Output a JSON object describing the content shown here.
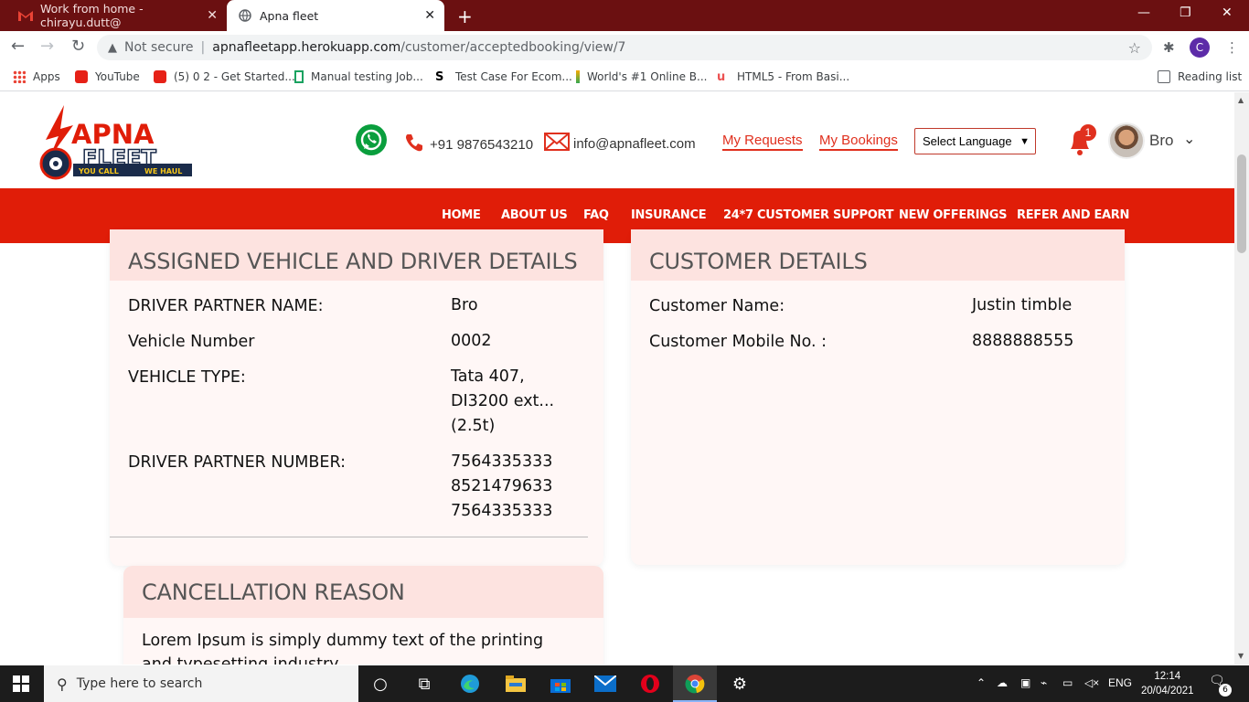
{
  "browser": {
    "tabs": [
      {
        "title": "Work from home - chirayu.dutt@",
        "active": false
      },
      {
        "title": "Apna fleet",
        "active": true
      }
    ],
    "new_tab": "+",
    "window_controls": {
      "minimize": "—",
      "maximize": "❐",
      "close": "✕"
    },
    "security_label": "Not secure",
    "url_host": "apnafleetapp.herokuapp.com",
    "url_path": "/customer/acceptedbooking/view/7",
    "profile_initial": "C",
    "bookmarks": [
      {
        "label": "Apps",
        "icon": "apps-grid-icon"
      },
      {
        "label": "YouTube",
        "icon": "youtube-icon"
      },
      {
        "label": "(5) 0 2 - Get Started...",
        "icon": "youtube-icon"
      },
      {
        "label": "Manual testing Job...",
        "icon": "bookmark-green-icon"
      },
      {
        "label": "Test Case For Ecom...",
        "icon": "s-logo-icon"
      },
      {
        "label": "World's #1 Online B...",
        "icon": "bars-icon"
      },
      {
        "label": "HTML5 - From Basi...",
        "icon": "udemy-icon"
      }
    ],
    "reading_list": "Reading list"
  },
  "site": {
    "logo": {
      "line1": "APNA",
      "line2": "FLEET",
      "tagline_left": "YOU CALL",
      "tagline_right": "WE HAUL"
    },
    "phone": "+91 9876543210",
    "email": "info@apnafleet.com",
    "my_requests": "My Requests",
    "my_bookings": "My Bookings",
    "language_select": "Select Language",
    "notification_count": "1",
    "user_name": "Bro",
    "nav": [
      "HOME",
      "ABOUT US",
      "FAQ",
      "INSURANCE",
      "24*7 CUSTOMER SUPPORT",
      "NEW OFFERINGS",
      "REFER AND EARN"
    ],
    "colors": {
      "brand_red": "#e01d08",
      "card_head": "#fde3e0",
      "card_bg": "#fff7f6"
    }
  },
  "vehicle_card": {
    "title": "ASSIGNED VEHICLE AND DRIVER DETAILS",
    "rows": [
      {
        "label": "DRIVER PARTNER NAME:",
        "value": "Bro"
      },
      {
        "label": "Vehicle Number",
        "value": "0002"
      },
      {
        "label": "VEHICLE TYPE:",
        "value_lines": [
          "Tata 407,",
          "DI3200 ext...",
          "(2.5t)"
        ]
      },
      {
        "label": "DRIVER PARTNER NUMBER:",
        "value_lines": [
          "7564335333",
          "8521479633",
          "7564335333"
        ]
      }
    ]
  },
  "customer_card": {
    "title": "CUSTOMER DETAILS",
    "rows": [
      {
        "label": "Customer Name:",
        "value": "Justin timble"
      },
      {
        "label": "Customer Mobile No. :",
        "value": "8888888555"
      }
    ]
  },
  "cancellation_card": {
    "title": "CANCELLATION REASON",
    "text": "Lorem Ipsum is simply dummy text of the printing and typesetting industry."
  },
  "taskbar": {
    "search_placeholder": "Type here to search",
    "language": "ENG",
    "time": "12:14",
    "date": "20/04/2021",
    "notification_count": "6"
  }
}
